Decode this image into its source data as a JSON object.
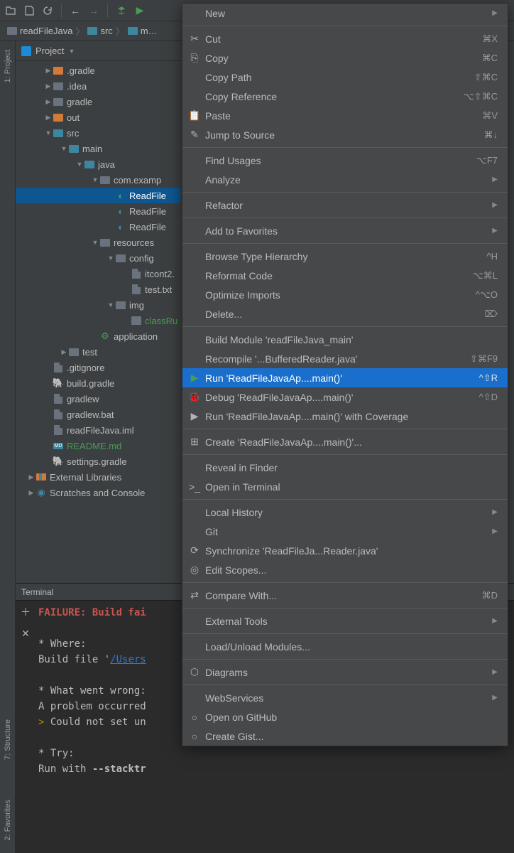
{
  "toolbar": {
    "icons": [
      "open",
      "save",
      "refresh",
      "back",
      "forward",
      "build",
      "run"
    ]
  },
  "breadcrumb": {
    "items": [
      "readFileJava",
      "src",
      "m…"
    ]
  },
  "sideTabs": {
    "project": "1: Project",
    "structure": "7: Structure",
    "favorites": "2: Favorites"
  },
  "projectPanel": {
    "title": "Project"
  },
  "tree": [
    {
      "d": 0,
      "a": "▶",
      "i": "folder-orange",
      "l": ".gradle"
    },
    {
      "d": 0,
      "a": "▶",
      "i": "folder-gray",
      "l": ".idea"
    },
    {
      "d": 0,
      "a": "▶",
      "i": "folder-gray",
      "l": "gradle"
    },
    {
      "d": 0,
      "a": "▶",
      "i": "folder-orange",
      "l": "out"
    },
    {
      "d": 0,
      "a": "▼",
      "i": "folder-blue",
      "l": "src"
    },
    {
      "d": 1,
      "a": "▼",
      "i": "folder-blue",
      "l": "main"
    },
    {
      "d": 2,
      "a": "▼",
      "i": "folder-blue",
      "l": "java"
    },
    {
      "d": 3,
      "a": "▼",
      "i": "folder-gray",
      "l": "com.examp"
    },
    {
      "d": 4,
      "a": "",
      "i": "run",
      "l": "ReadFile",
      "sel": true
    },
    {
      "d": 4,
      "a": "",
      "i": "run-b",
      "l": "ReadFile"
    },
    {
      "d": 4,
      "a": "",
      "i": "run-b",
      "l": "ReadFile"
    },
    {
      "d": 3,
      "a": "▼",
      "i": "folder-gray",
      "l": "resources"
    },
    {
      "d": 4,
      "a": "▼",
      "i": "folder-gray",
      "l": "config"
    },
    {
      "d": 5,
      "a": "",
      "i": "file",
      "l": "itcont2."
    },
    {
      "d": 5,
      "a": "",
      "i": "file",
      "l": "test.txt"
    },
    {
      "d": 4,
      "a": "▼",
      "i": "folder-gray",
      "l": "img"
    },
    {
      "d": 5,
      "a": "",
      "i": "img",
      "l": "classRu",
      "g": true
    },
    {
      "d": 3,
      "a": "",
      "i": "app",
      "l": "application"
    },
    {
      "d": 1,
      "a": "▶",
      "i": "folder-gray",
      "l": "test"
    },
    {
      "d": 0,
      "a": "",
      "i": "file",
      "l": ".gitignore"
    },
    {
      "d": 0,
      "a": "",
      "i": "gradle",
      "l": "build.gradle"
    },
    {
      "d": 0,
      "a": "",
      "i": "file",
      "l": "gradlew"
    },
    {
      "d": 0,
      "a": "",
      "i": "file",
      "l": "gradlew.bat"
    },
    {
      "d": 0,
      "a": "",
      "i": "file",
      "l": "readFileJava.iml"
    },
    {
      "d": 0,
      "a": "",
      "i": "md",
      "l": "README.md",
      "g": true
    },
    {
      "d": 0,
      "a": "",
      "i": "gradle",
      "l": "settings.gradle"
    }
  ],
  "treeBottom": [
    {
      "a": "▶",
      "i": "ext",
      "l": "External Libraries"
    },
    {
      "a": "▶",
      "i": "scr",
      "l": "Scratches and Console"
    }
  ],
  "terminal": {
    "title": "Terminal",
    "lines": [
      {
        "t": "FAILURE: Build fai",
        "c": "term-red"
      },
      {
        "t": ""
      },
      {
        "t": "* Where:"
      },
      {
        "pre": "Build file '",
        "link": "/Users"
      },
      {
        "t": ""
      },
      {
        "t": "* What went wrong:"
      },
      {
        "t": "A problem occurred"
      },
      {
        "caret": "> ",
        "t": "Could not set un"
      },
      {
        "t": ""
      },
      {
        "t": "* Try:"
      },
      {
        "pre": "Run with ",
        "bold": "--stacktr"
      }
    ]
  },
  "menu": [
    {
      "icon": "",
      "label": "New",
      "sub": true
    },
    {
      "sep": true
    },
    {
      "icon": "✂",
      "label": "Cut",
      "short": "⌘X"
    },
    {
      "icon": "⎘",
      "label": "Copy",
      "short": "⌘C"
    },
    {
      "icon": "",
      "label": "Copy Path",
      "short": "⇧⌘C"
    },
    {
      "icon": "",
      "label": "Copy Reference",
      "short": "⌥⇧⌘C"
    },
    {
      "icon": "📋",
      "label": "Paste",
      "short": "⌘V"
    },
    {
      "icon": "✎",
      "label": "Jump to Source",
      "short": "⌘↓"
    },
    {
      "sep": true
    },
    {
      "icon": "",
      "label": "Find Usages",
      "short": "⌥F7"
    },
    {
      "icon": "",
      "label": "Analyze",
      "sub": true
    },
    {
      "sep": true
    },
    {
      "icon": "",
      "label": "Refactor",
      "sub": true
    },
    {
      "sep": true
    },
    {
      "icon": "",
      "label": "Add to Favorites",
      "sub": true
    },
    {
      "sep": true
    },
    {
      "icon": "",
      "label": "Browse Type Hierarchy",
      "short": "^H"
    },
    {
      "icon": "",
      "label": "Reformat Code",
      "short": "⌥⌘L"
    },
    {
      "icon": "",
      "label": "Optimize Imports",
      "short": "^⌥O"
    },
    {
      "icon": "",
      "label": "Delete...",
      "short": "⌦"
    },
    {
      "sep": true
    },
    {
      "icon": "",
      "label": "Build Module 'readFileJava_main'"
    },
    {
      "icon": "",
      "label": "Recompile '...BufferedReader.java'",
      "short": "⇧⌘F9"
    },
    {
      "icon": "▶",
      "label": "Run 'ReadFileJavaAp....main()'",
      "short": "^⇧R",
      "hi": true,
      "green": true
    },
    {
      "icon": "🐞",
      "label": "Debug 'ReadFileJavaAp....main()'",
      "short": "^⇧D"
    },
    {
      "icon": "▶",
      "label": "Run 'ReadFileJavaAp....main()' with Coverage"
    },
    {
      "sep": true
    },
    {
      "icon": "⊞",
      "label": "Create 'ReadFileJavaAp....main()'..."
    },
    {
      "sep": true
    },
    {
      "icon": "",
      "label": "Reveal in Finder"
    },
    {
      "icon": ">_",
      "label": "Open in Terminal"
    },
    {
      "sep": true
    },
    {
      "icon": "",
      "label": "Local History",
      "sub": true
    },
    {
      "icon": "",
      "label": "Git",
      "sub": true
    },
    {
      "icon": "⟳",
      "label": "Synchronize 'ReadFileJa...Reader.java'"
    },
    {
      "icon": "◎",
      "label": "Edit Scopes..."
    },
    {
      "sep": true
    },
    {
      "icon": "⇄",
      "label": "Compare With...",
      "short": "⌘D"
    },
    {
      "sep": true
    },
    {
      "icon": "",
      "label": "External Tools",
      "sub": true
    },
    {
      "sep": true
    },
    {
      "icon": "",
      "label": "Load/Unload Modules..."
    },
    {
      "sep": true
    },
    {
      "icon": "⬡",
      "label": "Diagrams",
      "sub": true
    },
    {
      "sep": true
    },
    {
      "icon": "",
      "label": "WebServices",
      "sub": true
    },
    {
      "icon": "○",
      "label": "Open on GitHub"
    },
    {
      "icon": "○",
      "label": "Create Gist..."
    }
  ]
}
